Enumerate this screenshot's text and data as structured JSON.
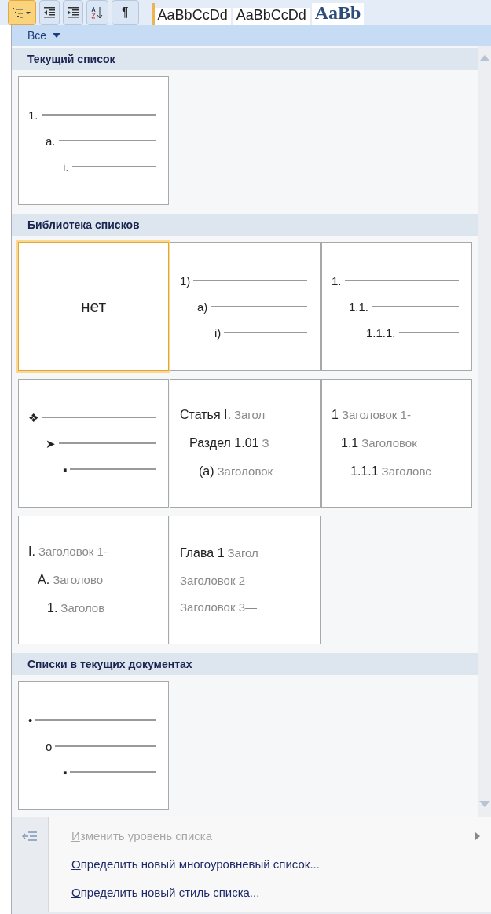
{
  "toolbar": {
    "buttons": [
      {
        "kind": "multilevel",
        "selected": true
      },
      {
        "kind": "outdent",
        "selected": false
      },
      {
        "kind": "indent",
        "selected": false
      },
      {
        "kind": "sort",
        "selected": false
      }
    ],
    "pilcrow": "¶",
    "styles": [
      {
        "label": "AaBbCcDd",
        "kind": "sans"
      },
      {
        "label": "AaBbCcDd",
        "kind": "sans"
      },
      {
        "label": "AaBb",
        "kind": "serif"
      }
    ]
  },
  "filter": {
    "label": "Все"
  },
  "sections": [
    {
      "title": "Текущий список",
      "tiles": [
        {
          "kind": "rules",
          "selected": false,
          "lines": [
            {
              "marker": "1."
            },
            {
              "marker": "a."
            },
            {
              "marker": "i."
            }
          ]
        }
      ]
    },
    {
      "title": "Библиотека списков",
      "tiles": [
        {
          "kind": "none",
          "selected": true,
          "text": "нет"
        },
        {
          "kind": "rules",
          "selected": false,
          "lines": [
            {
              "marker": "1)"
            },
            {
              "marker": "a)"
            },
            {
              "marker": "i)"
            }
          ]
        },
        {
          "kind": "rules",
          "selected": false,
          "lines": [
            {
              "marker": "1."
            },
            {
              "marker": "1.1."
            },
            {
              "marker": "1.1.1."
            }
          ]
        },
        {
          "kind": "rules",
          "selected": false,
          "lines": [
            {
              "marker": "❖"
            },
            {
              "marker": "➤"
            },
            {
              "marker": "▪"
            }
          ]
        },
        {
          "kind": "headings",
          "selected": false,
          "lines": [
            {
              "marker": "Статья I.",
              "label": "Загол"
            },
            {
              "marker": "Раздел 1.01",
              "label": "З"
            },
            {
              "marker": "(a)",
              "label": "Заголовок"
            }
          ]
        },
        {
          "kind": "headings",
          "selected": false,
          "lines": [
            {
              "marker": "1",
              "label": "Заголовок 1-"
            },
            {
              "marker": "1.1",
              "label": "Заголовок"
            },
            {
              "marker": "1.1.1",
              "label": "Заголовс"
            }
          ]
        },
        {
          "kind": "headings",
          "selected": false,
          "lines": [
            {
              "marker": "I.",
              "label": "Заголовок 1-"
            },
            {
              "marker": "A.",
              "label": "Заголово"
            },
            {
              "marker": "1.",
              "label": "Заголов"
            }
          ]
        },
        {
          "kind": "headings",
          "selected": false,
          "lines": [
            {
              "marker": "Глава 1",
              "label": "Загол"
            },
            {
              "label": "Заголовок 2—"
            },
            {
              "label": "Заголовок 3—"
            }
          ]
        }
      ]
    },
    {
      "title": "Списки в текущих документах",
      "tiles": [
        {
          "kind": "rules",
          "selected": false,
          "lines": [
            {
              "marker": "•"
            },
            {
              "marker": "o"
            },
            {
              "marker": "▪"
            }
          ]
        }
      ]
    }
  ],
  "menu": [
    {
      "label": "Изменить уровень списка",
      "disabled": true,
      "submenu": true,
      "icon": true
    },
    {
      "label": "Определить новый многоуровневый список...",
      "disabled": false,
      "submenu": false,
      "icon": false
    },
    {
      "label": "Определить новый стиль списка...",
      "disabled": false,
      "submenu": false,
      "icon": false
    }
  ]
}
